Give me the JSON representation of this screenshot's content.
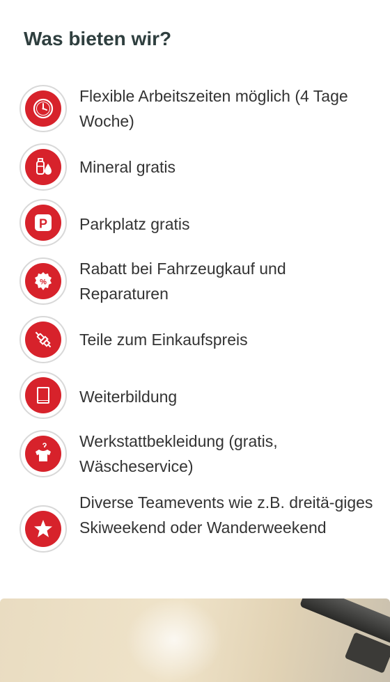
{
  "section": {
    "title": "Was bieten wir?"
  },
  "benefits": [
    {
      "icon": "clock-icon",
      "text": "Flexible Arbeitszeiten möglich (4 Tage Woche)"
    },
    {
      "icon": "water-bottle-icon",
      "text": "Mineral gratis"
    },
    {
      "icon": "parking-icon",
      "text": "Parkplatz gratis"
    },
    {
      "icon": "discount-badge-icon",
      "text": "Rabatt bei Fahrzeugkauf und Reparaturen"
    },
    {
      "icon": "spark-plug-icon",
      "text": "Teile zum Einkaufspreis"
    },
    {
      "icon": "book-icon",
      "text": "Weiterbildung"
    },
    {
      "icon": "shirt-on-hanger-icon",
      "text": "Werkstattbekleidung (gratis, Wäscheservice)"
    },
    {
      "icon": "star-icon",
      "text": "Diverse Teamevents wie z.B. dreitä-giges Skiweekend oder Wanderweekend"
    }
  ],
  "colors": {
    "accent": "#d7222b",
    "text": "#333333",
    "heading": "#2f3f3f",
    "ring": "#d8d8d8"
  }
}
